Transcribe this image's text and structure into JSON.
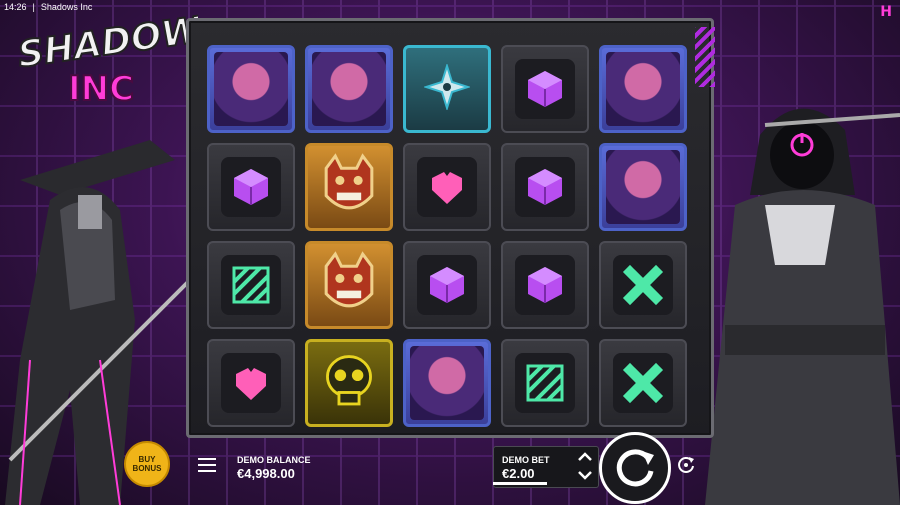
{
  "statusbar": {
    "time": "14:26",
    "separator": "|",
    "app_title": "Shadows Inc"
  },
  "logo": {
    "line1": "SHADOWS",
    "line2": "INC"
  },
  "brand_mark": "H",
  "colors": {
    "accent": "#ff3cd8",
    "purple_bg": "#3c1452",
    "cube_symbol": "#b84ef0",
    "heart_symbol": "#ff5fb8",
    "green_symbol": "#4ee8a8",
    "bonus_button": "#f0b418"
  },
  "reels": [
    [
      "ninja-portrait",
      "ninja-portrait",
      "shuriken",
      "purple-cube",
      "ninja-portrait"
    ],
    [
      "purple-cube",
      "oni-mask",
      "pink-heart",
      "purple-cube",
      "ninja-portrait"
    ],
    [
      "green-stripes",
      "oni-mask",
      "purple-cube",
      "purple-cube",
      "green-x"
    ],
    [
      "pink-heart",
      "skull",
      "ninja-portrait",
      "green-stripes",
      "green-x"
    ]
  ],
  "controls": {
    "buy_bonus_line1": "BUY",
    "buy_bonus_line2": "BONUS",
    "balance_label": "DEMO BALANCE",
    "balance_value": "€4,998.00",
    "bet_label": "DEMO BET",
    "bet_value": "€2.00",
    "menu_icon": "hamburger-icon",
    "spin_icon": "spin-arrow-icon",
    "autoplay_icon": "autoplay-icon"
  }
}
